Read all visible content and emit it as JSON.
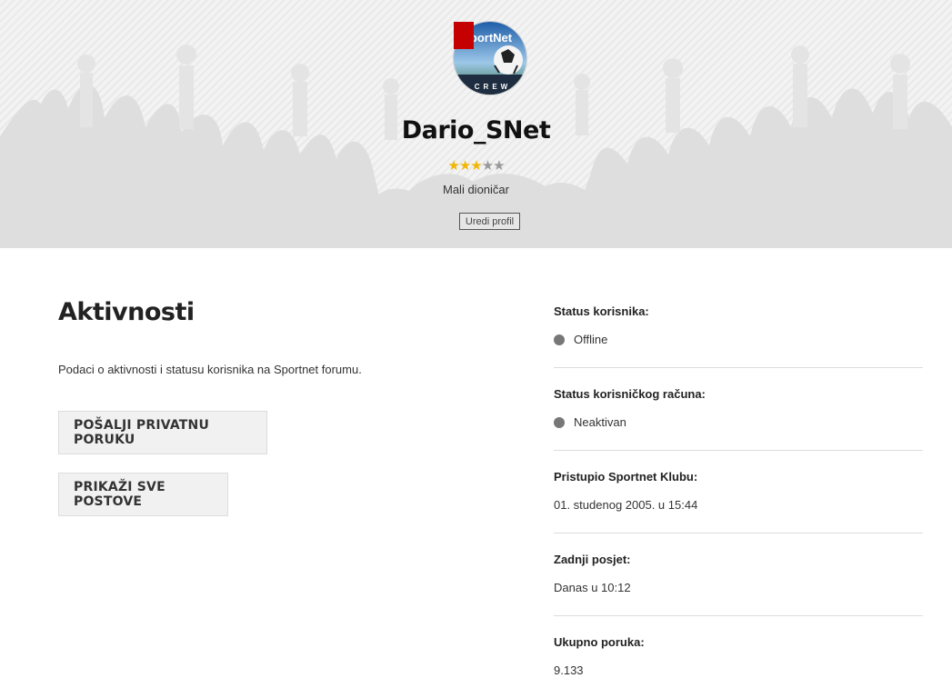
{
  "profile": {
    "username": "Dario_SNet",
    "rating": 3,
    "rating_max": 5,
    "rank": "Mali dioničar",
    "edit_label": "Uredi profil",
    "avatar_text": "portNet",
    "avatar_subtext": "CREW"
  },
  "activity": {
    "title": "Aktivnosti",
    "description": "Podaci o aktivnosti i statusu korisnika na Sportnet forumu.",
    "send_pm_label": "POŠALJI PRIVATNU PORUKU",
    "show_posts_label": "PRIKAŽI SVE POSTOVE"
  },
  "info": [
    {
      "label": "Status korisnika:",
      "value": "Offline",
      "dot": true
    },
    {
      "label": "Status korisničkog računa:",
      "value": "Neaktivan",
      "dot": true
    },
    {
      "label": "Pristupio Sportnet Klubu:",
      "value": "01. studenog 2005. u 15:44",
      "dot": false
    },
    {
      "label": "Zadnji posjet:",
      "value": "Danas u 10:12",
      "dot": false
    },
    {
      "label": "Ukupno poruka:",
      "value": "9.133",
      "dot": false
    }
  ],
  "colors": {
    "star_on": "#f2b705",
    "star_off": "#9a9a9a",
    "status_dot": "#777777",
    "badge": "#c40000"
  }
}
